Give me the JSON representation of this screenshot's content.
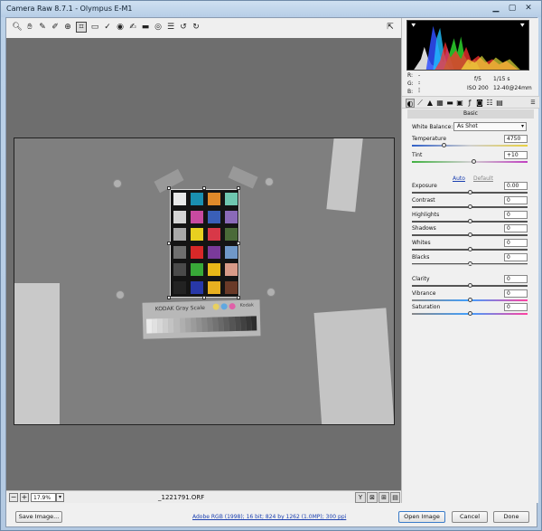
{
  "window": {
    "title": "Camera Raw 8.7.1  -  Olympus E-M1"
  },
  "toolbar": {
    "icons": [
      "zoom-icon",
      "hand-icon",
      "white-balance-icon",
      "color-sampler-icon",
      "targeted-adjustment-icon",
      "crop-icon",
      "straighten-icon",
      "spot-removal-icon",
      "red-eye-icon",
      "adjustment-brush-icon",
      "graduated-filter-icon",
      "radial-filter-icon",
      "preferences-icon",
      "rotate-ccw-icon",
      "rotate-cw-icon"
    ]
  },
  "readout": {
    "r_label": "R:",
    "r_value": "---",
    "g_label": "G:",
    "g_value": "---",
    "b_label": "B:",
    "b_value": "---",
    "aperture": "f/5",
    "shutter": "1/15 s",
    "iso": "ISO 200",
    "lens": "12-40@24mm"
  },
  "panel": {
    "section_title": "Basic",
    "white_balance_label": "White Balance:",
    "white_balance_value": "As Shot",
    "auto_label": "Auto",
    "default_label": "Default",
    "sliders": {
      "temperature": {
        "label": "Temperature",
        "value": "4750",
        "level": 0.27
      },
      "tint": {
        "label": "Tint",
        "value": "+10",
        "level": 0.53
      },
      "exposure": {
        "label": "Exposure",
        "value": "0.00",
        "level": 0.5
      },
      "contrast": {
        "label": "Contrast",
        "value": "0",
        "level": 0.5
      },
      "highlights": {
        "label": "Highlights",
        "value": "0",
        "level": 0.5
      },
      "shadows": {
        "label": "Shadows",
        "value": "0",
        "level": 0.5
      },
      "whites": {
        "label": "Whites",
        "value": "0",
        "level": 0.5
      },
      "blacks": {
        "label": "Blacks",
        "value": "0",
        "level": 0.5
      },
      "clarity": {
        "label": "Clarity",
        "value": "0",
        "level": 0.5
      },
      "vibrance": {
        "label": "Vibrance",
        "value": "0",
        "level": 0.5
      },
      "saturation": {
        "label": "Saturation",
        "value": "0",
        "level": 0.5
      }
    }
  },
  "photo": {
    "gray_card_label": "KODAK Gray Scale",
    "brand_label": "Kodak",
    "patch_colors": [
      "#e8e8e8",
      "#1a8fb0",
      "#e08a2a",
      "#6fc7b0",
      "#d4d4d4",
      "#c84aa0",
      "#3a5fb8",
      "#8a6ab8",
      "#a8a8a8",
      "#e8d020",
      "#d83848",
      "#4a6a38",
      "#6e6e6e",
      "#d82828",
      "#7a3a9a",
      "#7098c8",
      "#4a4a4a",
      "#38a838",
      "#e8b818",
      "#d89a88",
      "#222222",
      "#2838a8",
      "#e8b020",
      "#6a3a28"
    ]
  },
  "status": {
    "zoom": "17.9%",
    "filename": "_1221791.ORF"
  },
  "footer": {
    "save_label": "Save Image...",
    "workflow_label": "Adobe RGB (1998); 16 bit; 824 by 1262 (1.0MP); 300 ppi",
    "open_label": "Open Image",
    "cancel_label": "Cancel",
    "done_label": "Done"
  },
  "colors": {
    "accent": "#3a7bc8",
    "link": "#1a3fb0"
  }
}
